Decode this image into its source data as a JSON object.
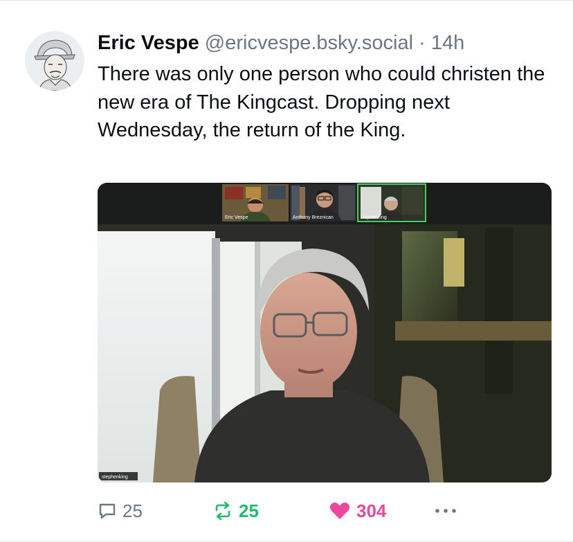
{
  "post": {
    "author_name": "Eric Vespe",
    "author_handle": "@ericvespe.bsky.social",
    "separator": "·",
    "timestamp": "14h",
    "text": "There was only one person who could christen the new era of The Kingcast. Dropping next Wednesday, the return of the King."
  },
  "video": {
    "participants": [
      "Eric Vespe",
      "Anthony Breznican",
      "stephenking"
    ],
    "active_speaker_label": "stephenking"
  },
  "actions": {
    "reply_count": "25",
    "repost_count": "25",
    "like_count": "304",
    "reply_icon": "speech-bubble-icon",
    "repost_icon": "repost-arrows-icon",
    "like_icon": "heart-icon",
    "more_icon": "ellipsis-icon"
  },
  "colors": {
    "repost_active": "#20bc6b",
    "like_active": "#ec4899",
    "muted_text": "#6b7683",
    "speaker_highlight": "#3fd35c"
  }
}
